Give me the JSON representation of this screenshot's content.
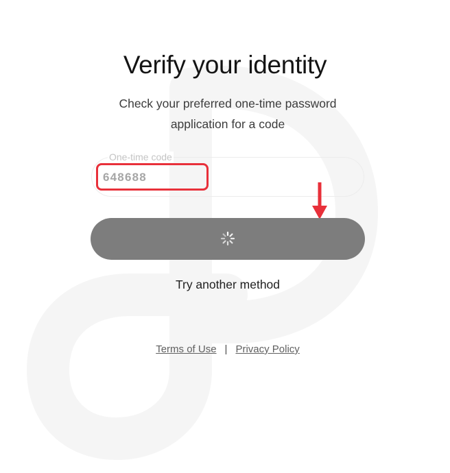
{
  "heading": "Verify your identity",
  "subtitle": "Check your preferred one-time password application for a code",
  "otp_field": {
    "label": "One-time code",
    "value": "648688"
  },
  "continue_button": {
    "state": "loading",
    "icon": "spinner-icon"
  },
  "alt_method_link": "Try another method",
  "footer": {
    "terms_link": "Terms of Use",
    "separator": "|",
    "privacy_link": "Privacy Policy"
  },
  "colors": {
    "annotation_red": "#e8303a",
    "button_gray": "#7d7d7d",
    "watermark": "#f4f4f4"
  }
}
